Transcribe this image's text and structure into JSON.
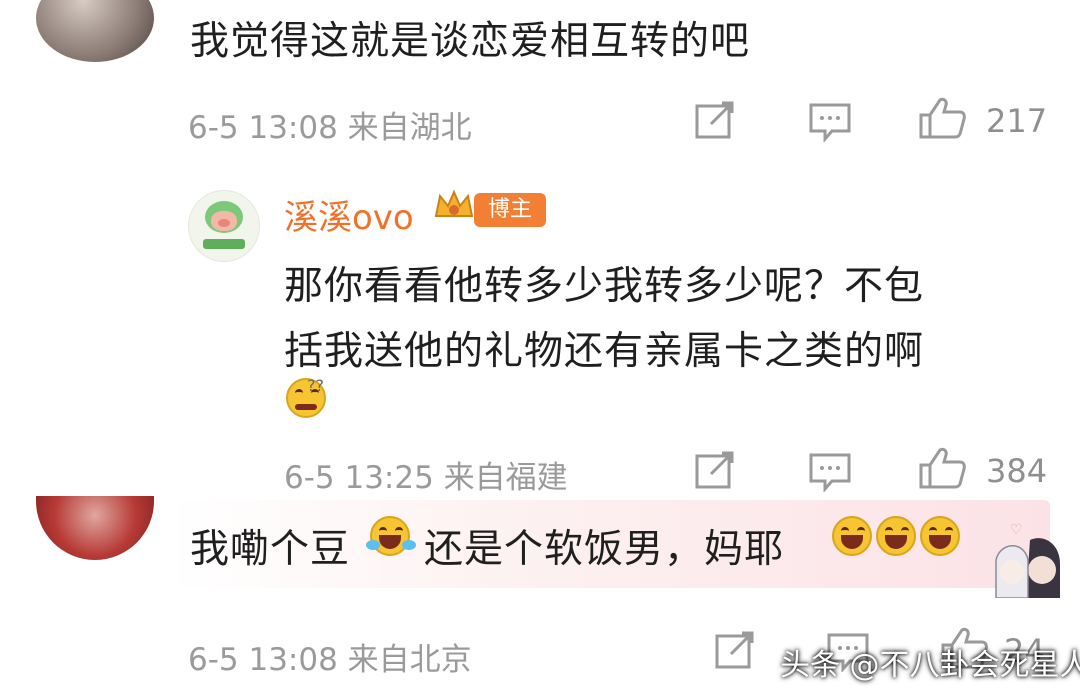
{
  "comments": [
    {
      "text": "我觉得这就是谈恋爱相互转的吧",
      "meta": "6-5 13:08 来自湖北",
      "likes": "217"
    },
    {
      "username": "溪溪ovo",
      "badge": "博主",
      "text_line1": "那你看看他转多少我转多少呢？不包",
      "text_line2": "括我送他的礼物还有亲属卡之类的啊",
      "meta": "6-5 13:25 来自福建",
      "likes": "384"
    },
    {
      "text_a": "我嘞个豆",
      "text_b": "还是个软饭男，妈耶",
      "meta": "6-5 13:08 来自北京",
      "likes": "24"
    }
  ],
  "watermark": "头条 @不八卦会死星人",
  "icons": {
    "share": "share-icon",
    "reply": "comment-icon",
    "like": "thumbs-up-icon"
  },
  "colors": {
    "username": "#f2712a",
    "badge": "#f27f33",
    "meta": "#9a9a9a"
  }
}
